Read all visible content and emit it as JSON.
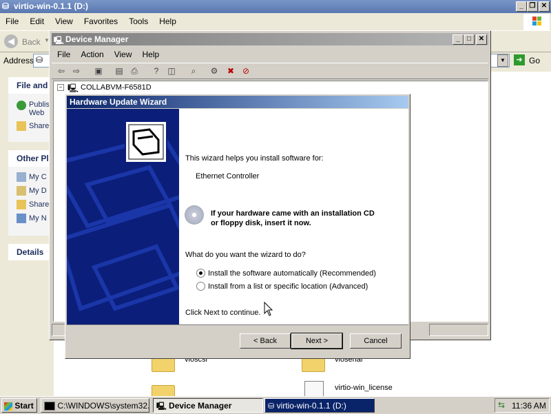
{
  "explorer": {
    "title": "virtio-win-0.1.1 (D:)",
    "menu": [
      "File",
      "Edit",
      "View",
      "Favorites",
      "Tools",
      "Help"
    ],
    "back_label": "Back",
    "address_label": "Address",
    "go_label": "Go",
    "tasks": {
      "file_header": "File and",
      "file_items": [
        "Publis Web",
        "Share"
      ],
      "other_header": "Other Pl",
      "other_items": [
        "My C",
        "My D",
        "Share",
        "My N"
      ],
      "details_header": "Details"
    },
    "files": [
      "vioscsi",
      "vioserial",
      "virtio-win_license"
    ]
  },
  "device_manager": {
    "title": "Device Manager",
    "menu": [
      "File",
      "Action",
      "View",
      "Help"
    ],
    "tree_root": "COLLABVM-F6581D"
  },
  "wizard": {
    "title": "Hardware Update Wizard",
    "intro": "This wizard helps you install software for:",
    "device": "Ethernet Controller",
    "cd_text_line1": "If your hardware came with an installation CD",
    "cd_text_line2": "or floppy disk, insert it now.",
    "question": "What do you want the wizard to do?",
    "options": [
      {
        "label": "Install the software automatically (Recommended)",
        "selected": true
      },
      {
        "label": "Install from a list or specific location (Advanced)",
        "selected": false
      }
    ],
    "continue_text": "Click Next to continue.",
    "buttons": {
      "back": "< Back",
      "next": "Next >",
      "cancel": "Cancel"
    }
  },
  "taskbar": {
    "start": "Start",
    "tasks": [
      "C:\\WINDOWS\\system32...",
      "Device Manager",
      "virtio-win-0.1.1 (D:)"
    ],
    "clock": "11:36 AM"
  },
  "colors": {
    "wizard_title": "#0a246a",
    "wizard_banner": "#0b1e7a",
    "inactive_title": "#808080"
  }
}
